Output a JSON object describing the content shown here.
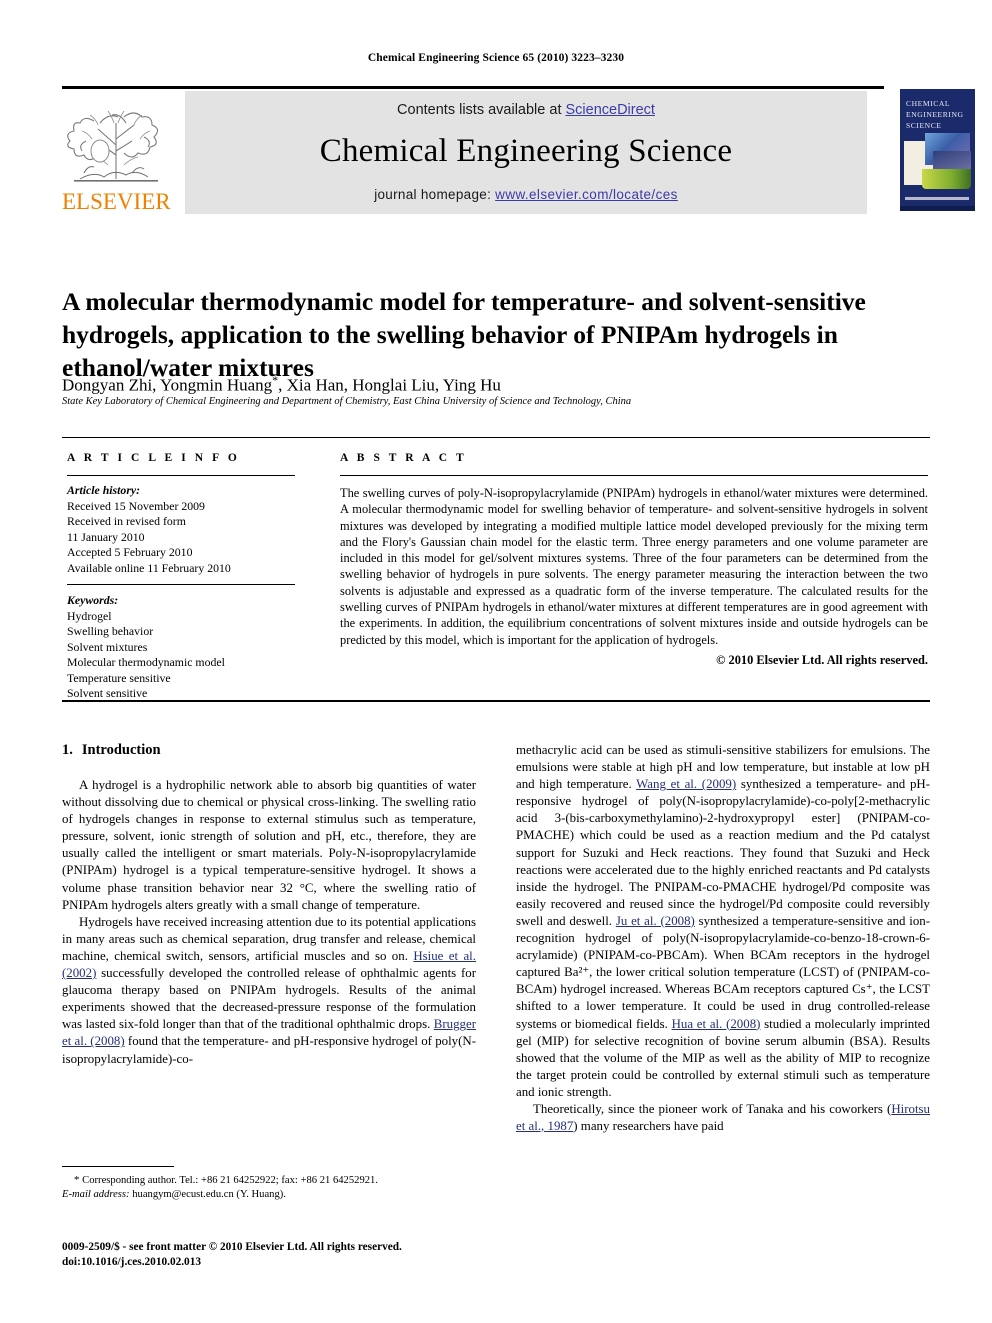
{
  "running_head": "Chemical Engineering Science 65 (2010) 3223–3230",
  "masthead": {
    "contents_prefix": "Contents lists available at ",
    "sciencedirect_link": "ScienceDirect",
    "journal_name": "Chemical Engineering Science",
    "homepage_prefix": "journal homepage: ",
    "homepage_url": "www.elsevier.com/locate/ces",
    "publisher_logo_text": "ELSEVIER",
    "cover_title": "CHEMICAL ENGINEERING SCIENCE",
    "link_color": "#3b3ba8",
    "cover_bg": "#1b2a6b",
    "logo_color": "#F08000"
  },
  "article": {
    "title": "A molecular thermodynamic model for temperature- and solvent-sensitive hydrogels, application to the swelling behavior of PNIPAm hydrogels in ethanol/water mixtures",
    "authors": "Dongyan Zhi, Yongmin Huang",
    "corresponding_marker": "*",
    "authors_rest": ", Xia Han, Honglai Liu, Ying Hu",
    "affiliation": "State Key Laboratory of Chemical Engineering and Department of Chemistry, East China University of Science and Technology, China"
  },
  "article_info": {
    "heading": "A R T I C L E   I N F O",
    "history_label": "Article history:",
    "history": [
      "Received 15 November 2009",
      "Received in revised form",
      "11 January 2010",
      "Accepted 5 February 2010",
      "Available online 11 February 2010"
    ],
    "keywords_label": "Keywords:",
    "keywords": [
      "Hydrogel",
      "Swelling behavior",
      "Solvent mixtures",
      "Molecular thermodynamic model",
      "Temperature sensitive",
      "Solvent sensitive"
    ]
  },
  "abstract": {
    "heading": "A B S T R A C T",
    "text": "The swelling curves of poly-N-isopropylacrylamide (PNIPAm) hydrogels in ethanol/water mixtures were determined. A molecular thermodynamic model for swelling behavior of temperature- and solvent-sensitive hydrogels in solvent mixtures was developed by integrating a modified multiple lattice model developed previously for the mixing term and the Flory's Gaussian chain model for the elastic term. Three energy parameters and one volume parameter are included in this model for gel/solvent mixtures systems. Three of the four parameters can be determined from the swelling behavior of hydrogels in pure solvents. The energy parameter measuring the interaction between the two solvents is adjustable and expressed as a quadratic form of the inverse temperature. The calculated results for the swelling curves of PNIPAm hydrogels in ethanol/water mixtures at different temperatures are in good agreement with the experiments. In addition, the equilibrium concentrations of solvent mixtures inside and outside hydrogels can be predicted by this model, which is important for the application of hydrogels.",
    "copyright": "© 2010 Elsevier Ltd. All rights reserved."
  },
  "body": {
    "section_number": "1.",
    "section_title": "Introduction",
    "left_paragraphs": [
      "A hydrogel is a hydrophilic network able to absorb big quantities of water without dissolving due to chemical or physical cross-linking. The swelling ratio of hydrogels changes in response to external stimulus such as temperature, pressure, solvent, ionic strength of solution and pH, etc., therefore, they are usually called the intelligent or smart materials. Poly-N-isopropylacrylamide (PNIPAm) hydrogel is a typical temperature-sensitive hydrogel. It shows a volume phase transition behavior near 32 °C, where the swelling ratio of PNIPAm hydrogels alters greatly with a small change of temperature."
    ],
    "left_para2_a": "Hydrogels have received increasing attention due to its potential applications in many areas such as chemical separation, drug transfer and release, chemical machine, chemical switch, sensors, artificial muscles and so on. ",
    "left_para2_ref1": "Hsiue et al. (2002)",
    "left_para2_b": " successfully developed the controlled release of ophthalmic agents for glaucoma therapy based on PNIPAm hydrogels. Results of the animal experiments showed that the decreased-pressure response of the formulation was lasted six-fold longer than that of the traditional ophthalmic drops. ",
    "left_para2_ref2": "Brugger et al. (2008)",
    "left_para2_c": " found that the temperature- and pH-responsive hydrogel of poly(N-isopropylacrylamide)-co-",
    "right_para1_a": "methacrylic acid can be used as stimuli-sensitive stabilizers for emulsions. The emulsions were stable at high pH and low temperature, but instable at low pH and high temperature. ",
    "right_para1_ref1": "Wang et al. (2009)",
    "right_para1_b": " synthesized a temperature- and pH-responsive hydrogel of poly(N-isopropylacrylamide)-co-poly[2-methacrylic acid 3-(bis-carboxymethylamino)-2-hydroxypropyl ester] (PNIPAM-co-PMACHE) which could be used as a reaction medium and the Pd catalyst support for Suzuki and Heck reactions. They found that Suzuki and Heck reactions were accelerated due to the highly enriched reactants and Pd catalysts inside the hydrogel. The PNIPAM-co-PMACHE hydrogel/Pd composite was easily recovered and reused since the hydrogel/Pd composite could reversibly swell and deswell. ",
    "right_para1_ref2": "Ju et al. (2008)",
    "right_para1_c": " synthesized a temperature-sensitive and ion-recognition hydrogel of poly(N-isopropylacrylamide-co-benzo-18-crown-6-acrylamide) (PNIPAM-co-PBCAm). When BCAm receptors in the hydrogel captured Ba²⁺, the lower critical solution temperature (LCST) of (PNIPAM-co-BCAm) hydrogel increased. Whereas BCAm receptors captured Cs⁺, the LCST shifted to a lower temperature. It could be used in drug controlled-release systems or biomedical fields. ",
    "right_para1_ref3": "Hua et al. (2008)",
    "right_para1_d": " studied a molecularly imprinted gel (MIP) for selective recognition of bovine serum albumin (BSA). Results showed that the volume of the MIP as well as the ability of MIP to recognize the target protein could be controlled by external stimuli such as temperature and ionic strength.",
    "right_para2_a": "Theoretically, since the pioneer work of Tanaka and his coworkers (",
    "right_para2_ref1": "Hirotsu et al., 1987",
    "right_para2_b": ") many researchers have paid"
  },
  "footnote": {
    "marker": "*",
    "corresponding": " Corresponding author. Tel.: +86 21 64252922; fax: +86 21 64252921.",
    "email_label": "E-mail address:",
    "email_value": " huangym@ecust.edu.cn (Y. Huang)."
  },
  "imprint": {
    "line1": "0009-2509/$ - see front matter © 2010 Elsevier Ltd. All rights reserved.",
    "line2": "doi:10.1016/j.ces.2010.02.013"
  }
}
